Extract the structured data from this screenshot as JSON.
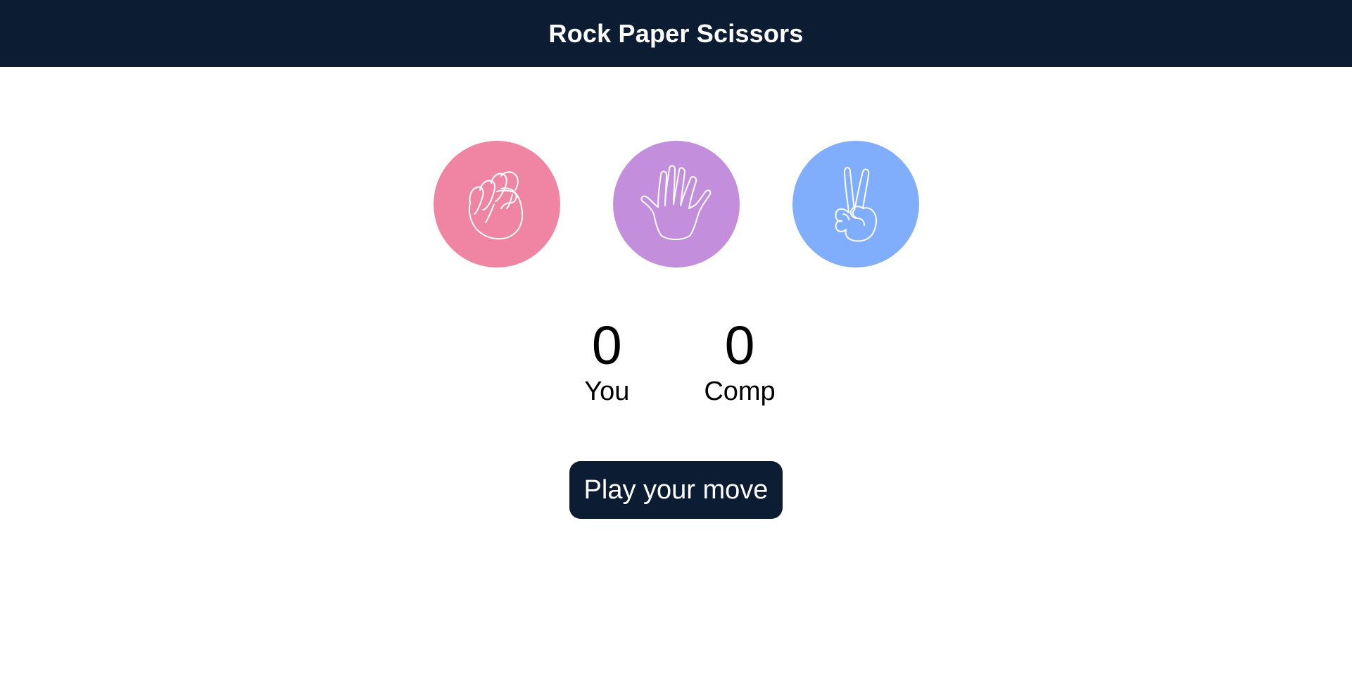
{
  "header": {
    "title": "Rock Paper Scissors"
  },
  "choices": [
    {
      "id": "rock",
      "icon": "fist-icon",
      "color": "#ef85a2"
    },
    {
      "id": "paper",
      "icon": "open-hand-icon",
      "color": "#c38fdd"
    },
    {
      "id": "scissors",
      "icon": "peace-hand-icon",
      "color": "#80aefc"
    }
  ],
  "scores": {
    "user": {
      "value": "0",
      "label": "You"
    },
    "computer": {
      "value": "0",
      "label": "Comp"
    }
  },
  "msg": {
    "label": "Play your move",
    "background": "#0b1c33"
  },
  "theme": {
    "header_bg": "#0b1c33",
    "text_light": "#ffffff"
  }
}
